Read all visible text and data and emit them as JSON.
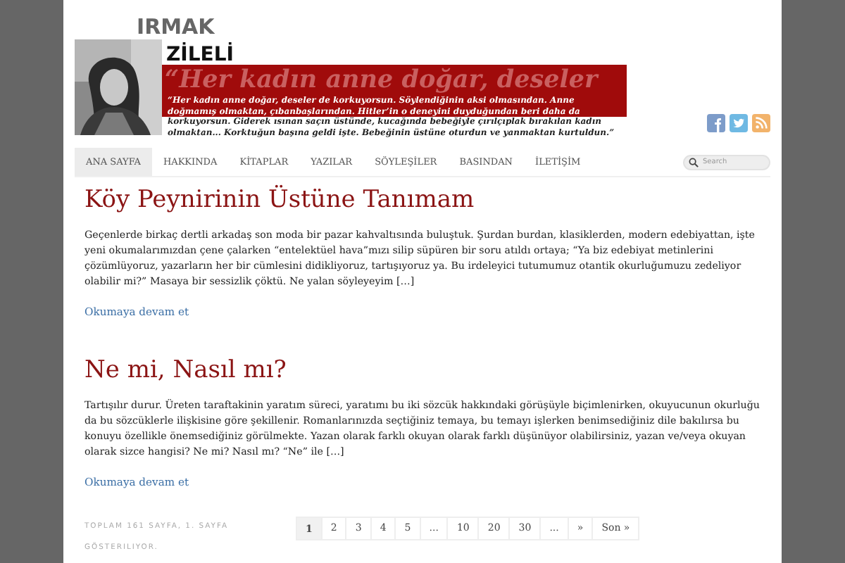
{
  "header": {
    "name_first": "IRMAK",
    "name_last": "ZİLELİ",
    "banner_big": "“Her kadın anne doğar, deseler",
    "quote_in_banner": "“Her kadın anne doğar, deseler de korkuyorsun. Söylendiğinin aksi olmasından. Anne doğmamış olmaktan, çıbanbaşlarından. Hitler’in o deneyini duyduğundan beri daha da",
    "quote_below": "korkuyorsun. Giderek ısınan saçın üstünde, kucağında bebeğiyle çırılçıplak bırakılan kadın olmaktan... Korktuğun başına geldi işte. Bebeğinin üstüne oturdun ve yanmaktan kurtuldun.”",
    "social": [
      {
        "kind": "facebook"
      },
      {
        "kind": "twitter"
      },
      {
        "kind": "rss"
      }
    ]
  },
  "nav": {
    "items": [
      {
        "label": "ANA SAYFA",
        "selected": true
      },
      {
        "label": "HAKKINDA",
        "selected": false
      },
      {
        "label": "KİTAPLAR",
        "selected": false
      },
      {
        "label": "YAZILAR",
        "selected": false
      },
      {
        "label": "SÖYLEŞİLER",
        "selected": false
      },
      {
        "label": "BASINDAN",
        "selected": false
      },
      {
        "label": "İLETİŞİM",
        "selected": false
      }
    ],
    "search": {
      "placeholder": "Search"
    }
  },
  "posts": [
    {
      "title": "Köy Peynirinin Üstüne Tanımam",
      "excerpt": "Geçenlerde birkaç dertli arkadaş son moda bir pazar kahvaltısında buluştuk. Şurdan burdan, klasiklerden, modern edebiyattan, işte yeni okumalarımızdan çene çalarken “entelektüel hava”mızı silip süpüren bir soru atıldı ortaya; “Ya biz edebiyat metinlerini çözümlüyoruz, yazarların her bir cümlesini didikliyoruz, tartışıyoruz ya. Bu irdeleyici tutumumuz otantik okurluğumuzu zedeliyor olabilir mi?” Masaya bir sessizlik çöktü. Ne yalan söyleyeyim […]",
      "more": "Okumaya devam et"
    },
    {
      "title": "Ne mi, Nasıl mı?",
      "excerpt": "Tartışılır durur. Üreten taraftakinin yaratım süreci, yaratımı bu iki sözcük hakkındaki görüşüyle biçimlenirken, okuyucunun okurluğu da bu sözcüklerle ilişkisine göre şekillenir. Romanlarınızda seçtiğiniz temaya, bu temayı işlerken benimsediğiniz dile bakılırsa bu konuyu özellikle önemsediğiniz görülmekte. Yazan olarak farklı okuyan olarak farklı düşünüyor olabilirsiniz, yazan ve/veya okuyan olarak sizce hangisi? Ne mi? Nasıl mı? “Ne” ile […]",
      "more": "Okumaya devam et"
    }
  ],
  "pagination": {
    "info": "TOPLAM 161 SAYFA, 1. SAYFA GÖSTERILIYOR.",
    "pages": [
      {
        "label": "1",
        "selected": true
      },
      {
        "label": "2",
        "selected": false
      },
      {
        "label": "3",
        "selected": false
      },
      {
        "label": "4",
        "selected": false
      },
      {
        "label": "5",
        "selected": false
      },
      {
        "label": "...",
        "selected": false
      },
      {
        "label": "10",
        "selected": false
      },
      {
        "label": "20",
        "selected": false
      },
      {
        "label": "30",
        "selected": false
      },
      {
        "label": "...",
        "selected": false
      },
      {
        "label": "»",
        "selected": false
      },
      {
        "label": "Son »",
        "selected": false
      }
    ]
  }
}
